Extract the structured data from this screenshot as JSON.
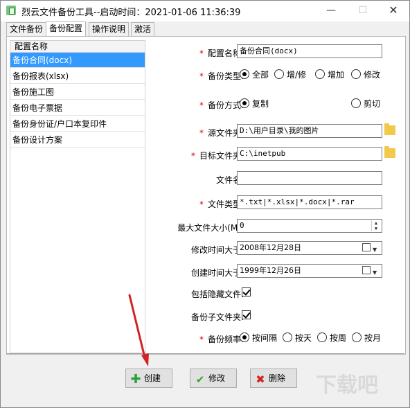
{
  "window": {
    "title": "烈云文件备份工具--启动时间：2021-01-06 11:36:39",
    "minimize": "—",
    "maximize": "☐",
    "close": "✕"
  },
  "tabs": [
    {
      "label": "文件备份"
    },
    {
      "label": "备份配置",
      "active": true
    },
    {
      "label": "操作说明"
    },
    {
      "label": "激活"
    }
  ],
  "list": {
    "header": "配置名称",
    "items": [
      {
        "label": "备份合同(docx)",
        "selected": true
      },
      {
        "label": "备份报表(xlsx)"
      },
      {
        "label": "备份施工图"
      },
      {
        "label": "备份电子票据"
      },
      {
        "label": "备份身份证/户口本复印件"
      },
      {
        "label": "备份设计方案"
      }
    ]
  },
  "form": {
    "config_name": {
      "label": "配置名称:",
      "value": "备份合同(docx)"
    },
    "backup_type": {
      "label": "备份类型:",
      "options": [
        "全部",
        "增/修",
        "增加",
        "修改"
      ],
      "selected": "全部"
    },
    "backup_method": {
      "label": "备份方式:",
      "options": [
        "复制",
        "剪切"
      ],
      "selected": "复制"
    },
    "source_folder": {
      "label": "源文件夹:",
      "value": "D:\\用户目录\\我的图片"
    },
    "target_folder": {
      "label": "目标文件夹:",
      "value": "C:\\inetpub"
    },
    "file_name": {
      "label": "文件名:",
      "value": ""
    },
    "file_type": {
      "label": "文件类型:",
      "value": "*.txt|*.xlsx|*.docx|*.rar"
    },
    "max_file_size": {
      "label": "最大文件大小(M):",
      "value": "0"
    },
    "modified_after": {
      "label": "修改时间大于:",
      "value": "2008年12月28日"
    },
    "created_after": {
      "label": "创建时间大于:",
      "value": "1999年12月26日"
    },
    "include_hidden": {
      "label": "包括隐藏文件:",
      "checked": true
    },
    "backup_subfolders": {
      "label": "备份子文件夹:",
      "checked": true
    },
    "backup_frequency": {
      "label": "备份频率:",
      "options": [
        "按间隔",
        "按天",
        "按周",
        "按月"
      ],
      "selected": "按间隔"
    },
    "required_mark": "*"
  },
  "buttons": {
    "create": "创建",
    "modify": "修改",
    "delete": "删除"
  },
  "colors": {
    "selection": "#3399ff",
    "required": "#d00000",
    "annotation_arrow": "#d32222"
  }
}
